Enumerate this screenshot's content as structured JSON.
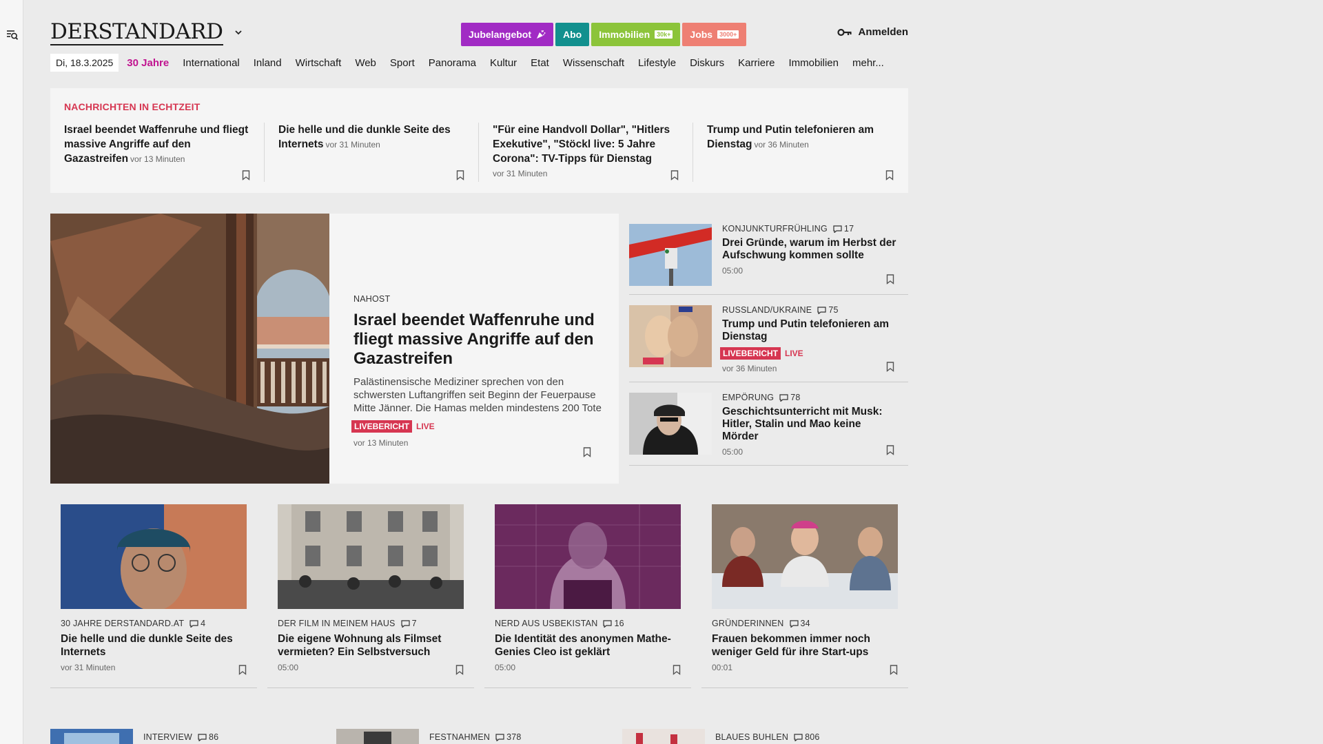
{
  "sidebar": {
    "menu_icon": "menu-search-icon"
  },
  "header": {
    "logo": "DERSTANDARD",
    "pills": [
      {
        "label": "Jubelangebot",
        "color": "#a12bc4",
        "icon": "party-popper-icon",
        "tag": ""
      },
      {
        "label": "Abo",
        "color": "#12908e",
        "icon": "",
        "tag": ""
      },
      {
        "label": "Immobilien",
        "color": "#8cc43a",
        "icon": "",
        "tag": "30k+"
      },
      {
        "label": "Jobs",
        "color": "#ee7f73",
        "icon": "",
        "tag": "3000+"
      }
    ],
    "login": "Anmelden"
  },
  "nav": {
    "date": "Di, 18.3.2025",
    "items": [
      "30 Jahre",
      "International",
      "Inland",
      "Wirtschaft",
      "Web",
      "Sport",
      "Panorama",
      "Kultur",
      "Etat",
      "Wissenschaft",
      "Lifestyle",
      "Diskurs",
      "Karriere",
      "Immobilien",
      "mehr..."
    ]
  },
  "ticker": {
    "title": "NACHRICHTEN IN ECHTZEIT",
    "items": [
      {
        "headline": "Israel beendet Waffenruhe und fliegt massive Angriffe auf den Gazastreifen",
        "time": "vor 13 Minuten"
      },
      {
        "headline": "Die helle und die dunkle Seite des Internets",
        "time": "vor 31 Minuten"
      },
      {
        "headline": "\"Für eine Handvoll Dollar\", \"Hitlers Exekutive\", \"Stöckl live: 5 Jahre Corona\": TV-Tipps für Dienstag",
        "time": "vor 31 Minuten"
      },
      {
        "headline": "Trump und Putin telefonieren am Dienstag",
        "time": "vor 36 Minuten"
      }
    ]
  },
  "lead": {
    "kicker": "NAHOST",
    "title": "Israel beendet Waffenruhe und fliegt massive Angriffe auf den Gazastreifen",
    "teaser": "Palästinensische Mediziner sprechen von den schwersten Luftangriffen seit Beginn der Feuerpause Mitte Jänner. Die Hamas melden mindestens 200 Tote",
    "badge": "LIVEBERICHT",
    "live": "LIVE",
    "time": "vor 13 Minuten"
  },
  "side": [
    {
      "kicker": "KONJUNKTURFRÜHLING",
      "comments": "17",
      "title": "Drei Gründe, warum im Herbst der Aufschwung kommen sollte",
      "time": "05:00",
      "badge": "",
      "live": ""
    },
    {
      "kicker": "RUSSLAND/UKRAINE",
      "comments": "75",
      "title": "Trump und Putin telefonieren am Dienstag",
      "time": "vor 36 Minuten",
      "badge": "LIVEBERICHT",
      "live": "LIVE"
    },
    {
      "kicker": "EMPÖRUNG",
      "comments": "78",
      "title": "Geschichtsunterricht mit Musk: Hitler, Stalin und Mao keine Mörder",
      "time": "05:00",
      "badge": "",
      "live": ""
    }
  ],
  "cards": [
    {
      "kicker": "30 JAHRE DERSTANDARD.AT",
      "comments": "4",
      "title": "Die helle und die dunkle Seite des Internets",
      "time": "vor 31 Minuten"
    },
    {
      "kicker": "DER FILM IN MEINEM HAUS",
      "comments": "7",
      "title": "Die eigene Wohnung als Filmset vermieten? Ein Selbstversuch",
      "time": "05:00"
    },
    {
      "kicker": "NERD AUS USBEKISTAN",
      "comments": "16",
      "title": "Die Identität des anonymen Mathe-Genies Cleo ist geklärt",
      "time": "05:00"
    },
    {
      "kicker": "GRÜNDERINNEN",
      "comments": "34",
      "title": "Frauen bekommen immer noch weniger Geld für ihre Start-ups",
      "time": "00:01"
    }
  ],
  "bottom": [
    {
      "kicker": "INTERVIEW",
      "comments": "86"
    },
    {
      "kicker": "FESTNAHMEN",
      "comments": "378"
    },
    {
      "kicker": "BLAUES BUHLEN",
      "comments": "806"
    }
  ],
  "colors": {
    "accent_red": "#d63651",
    "highlight_magenta": "#c0138f"
  }
}
